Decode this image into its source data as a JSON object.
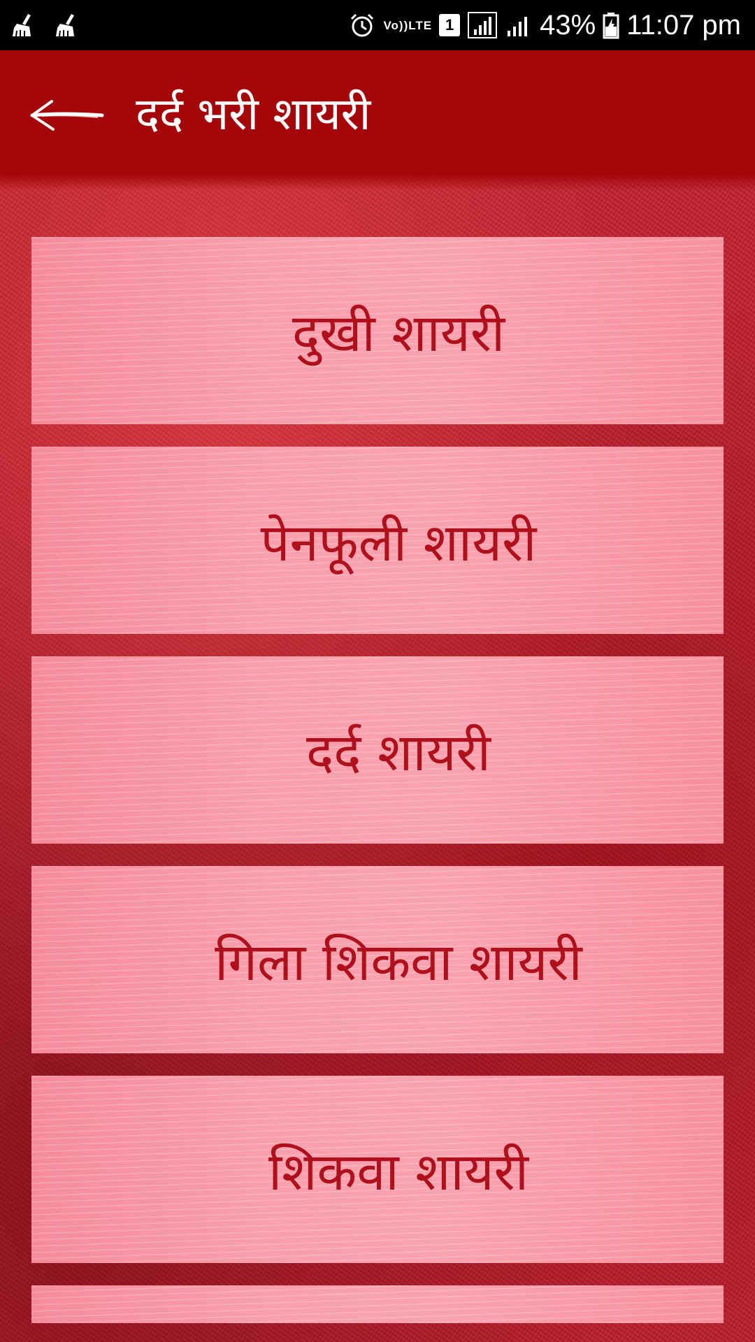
{
  "status_bar": {
    "notification_icons": [
      "cleaner-broom-icon",
      "cleaner-broom-icon"
    ],
    "volte_top": "Vo))",
    "volte_bottom": "LTE",
    "sim_slot": "1",
    "battery_percent": "43%",
    "time": "11:07 pm"
  },
  "app_bar": {
    "back_icon": "back-arrow-icon",
    "title": "दर्द भरी शायरी",
    "background_color": "#a5060a"
  },
  "list": {
    "items": [
      {
        "label": "दुखी शायरी"
      },
      {
        "label": "पेनफूली शायरी"
      },
      {
        "label": "दर्द शायरी"
      },
      {
        "label": "गिला शिकवा शायरी"
      },
      {
        "label": "शिकवा शायरी"
      },
      {
        "label": ""
      }
    ],
    "label_color": "#b0101c"
  }
}
